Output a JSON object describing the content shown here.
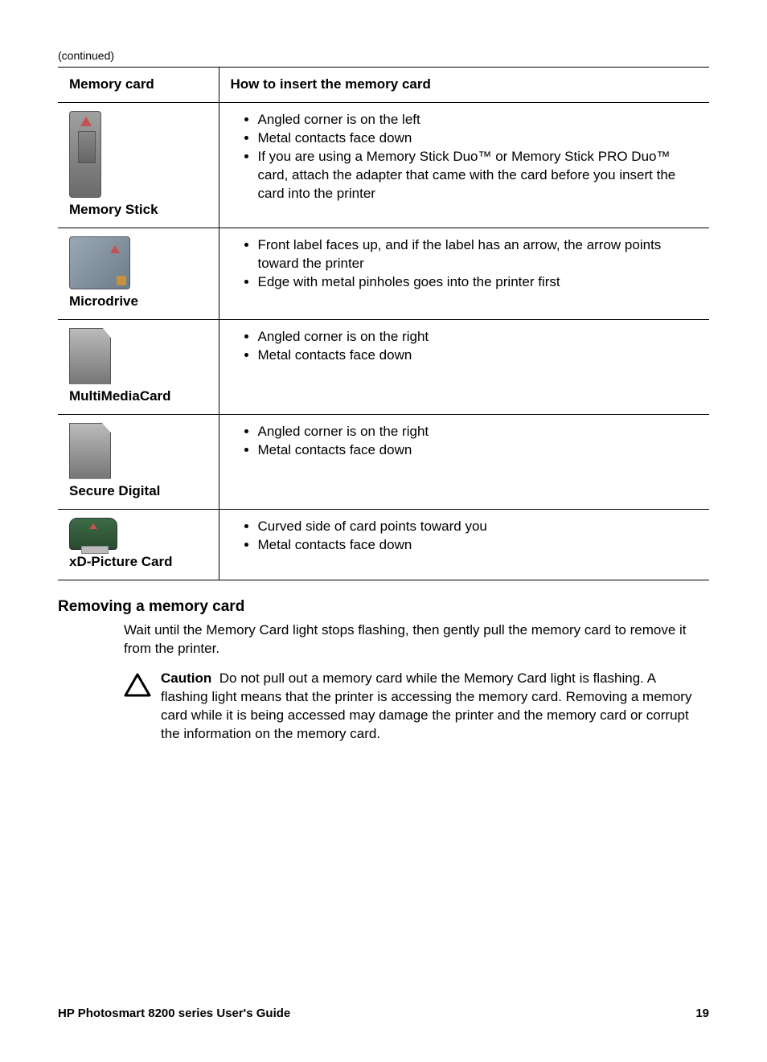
{
  "continued": "(continued)",
  "table": {
    "header_left": "Memory card",
    "header_right": "How to insert the memory card",
    "rows": [
      {
        "name": "Memory Stick",
        "bullets": [
          "Angled corner is on the left",
          "Metal contacts face down",
          "If you are using a Memory Stick Duo™ or Memory Stick PRO Duo™ card, attach the adapter that came with the card before you insert the card into the printer"
        ]
      },
      {
        "name": "Microdrive",
        "bullets": [
          "Front label faces up, and if the label has an arrow, the arrow points toward the printer",
          "Edge with metal pinholes goes into the printer first"
        ]
      },
      {
        "name": "MultiMediaCard",
        "bullets": [
          "Angled corner is on the right",
          "Metal contacts face down"
        ]
      },
      {
        "name": "Secure Digital",
        "bullets": [
          "Angled corner is on the right",
          "Metal contacts face down"
        ]
      },
      {
        "name": "xD-Picture Card",
        "bullets": [
          "Curved side of card points toward you",
          "Metal contacts face down"
        ]
      }
    ]
  },
  "section_heading": "Removing a memory card",
  "section_body": "Wait until the Memory Card light stops flashing, then gently pull the memory card to remove it from the printer.",
  "caution_label": "Caution",
  "caution_body": "Do not pull out a memory card while the Memory Card light is flashing. A flashing light means that the printer is accessing the memory card. Removing a memory card while it is being accessed may damage the printer and the memory card or corrupt the information on the memory card.",
  "footer_left": "HP Photosmart 8200 series User's Guide",
  "footer_right": "19"
}
